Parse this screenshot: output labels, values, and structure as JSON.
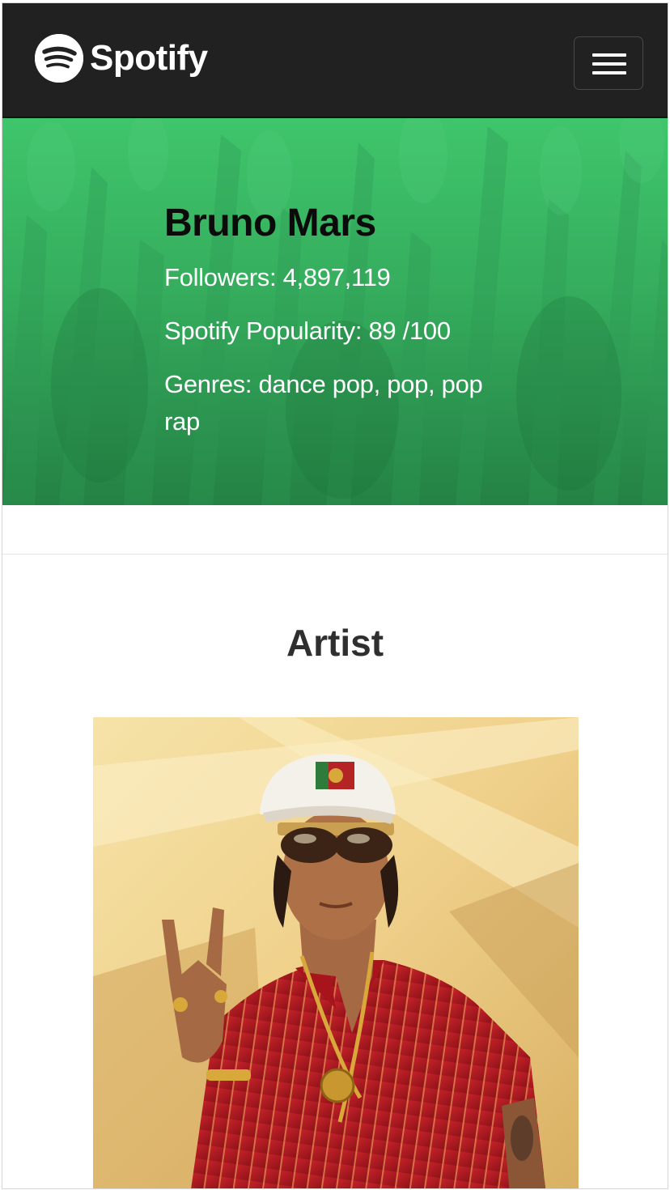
{
  "navbar": {
    "brand": "Spotify",
    "logo_icon": "spotify-logo-icon",
    "menu_icon": "hamburger-menu-icon"
  },
  "hero": {
    "artist_name": "Bruno Mars",
    "followers": "Followers: 4,897,119",
    "popularity": "Spotify Popularity: 89 /100",
    "genres": "Genres: dance pop, pop, pop rap"
  },
  "section": {
    "title": "Artist"
  },
  "colors": {
    "navbar_bg": "#212121",
    "hero_top": "#3fc56b",
    "hero_bottom": "#248144",
    "artist_name_color": "#0b0b0b",
    "hero_text_color": "#ffffff"
  }
}
